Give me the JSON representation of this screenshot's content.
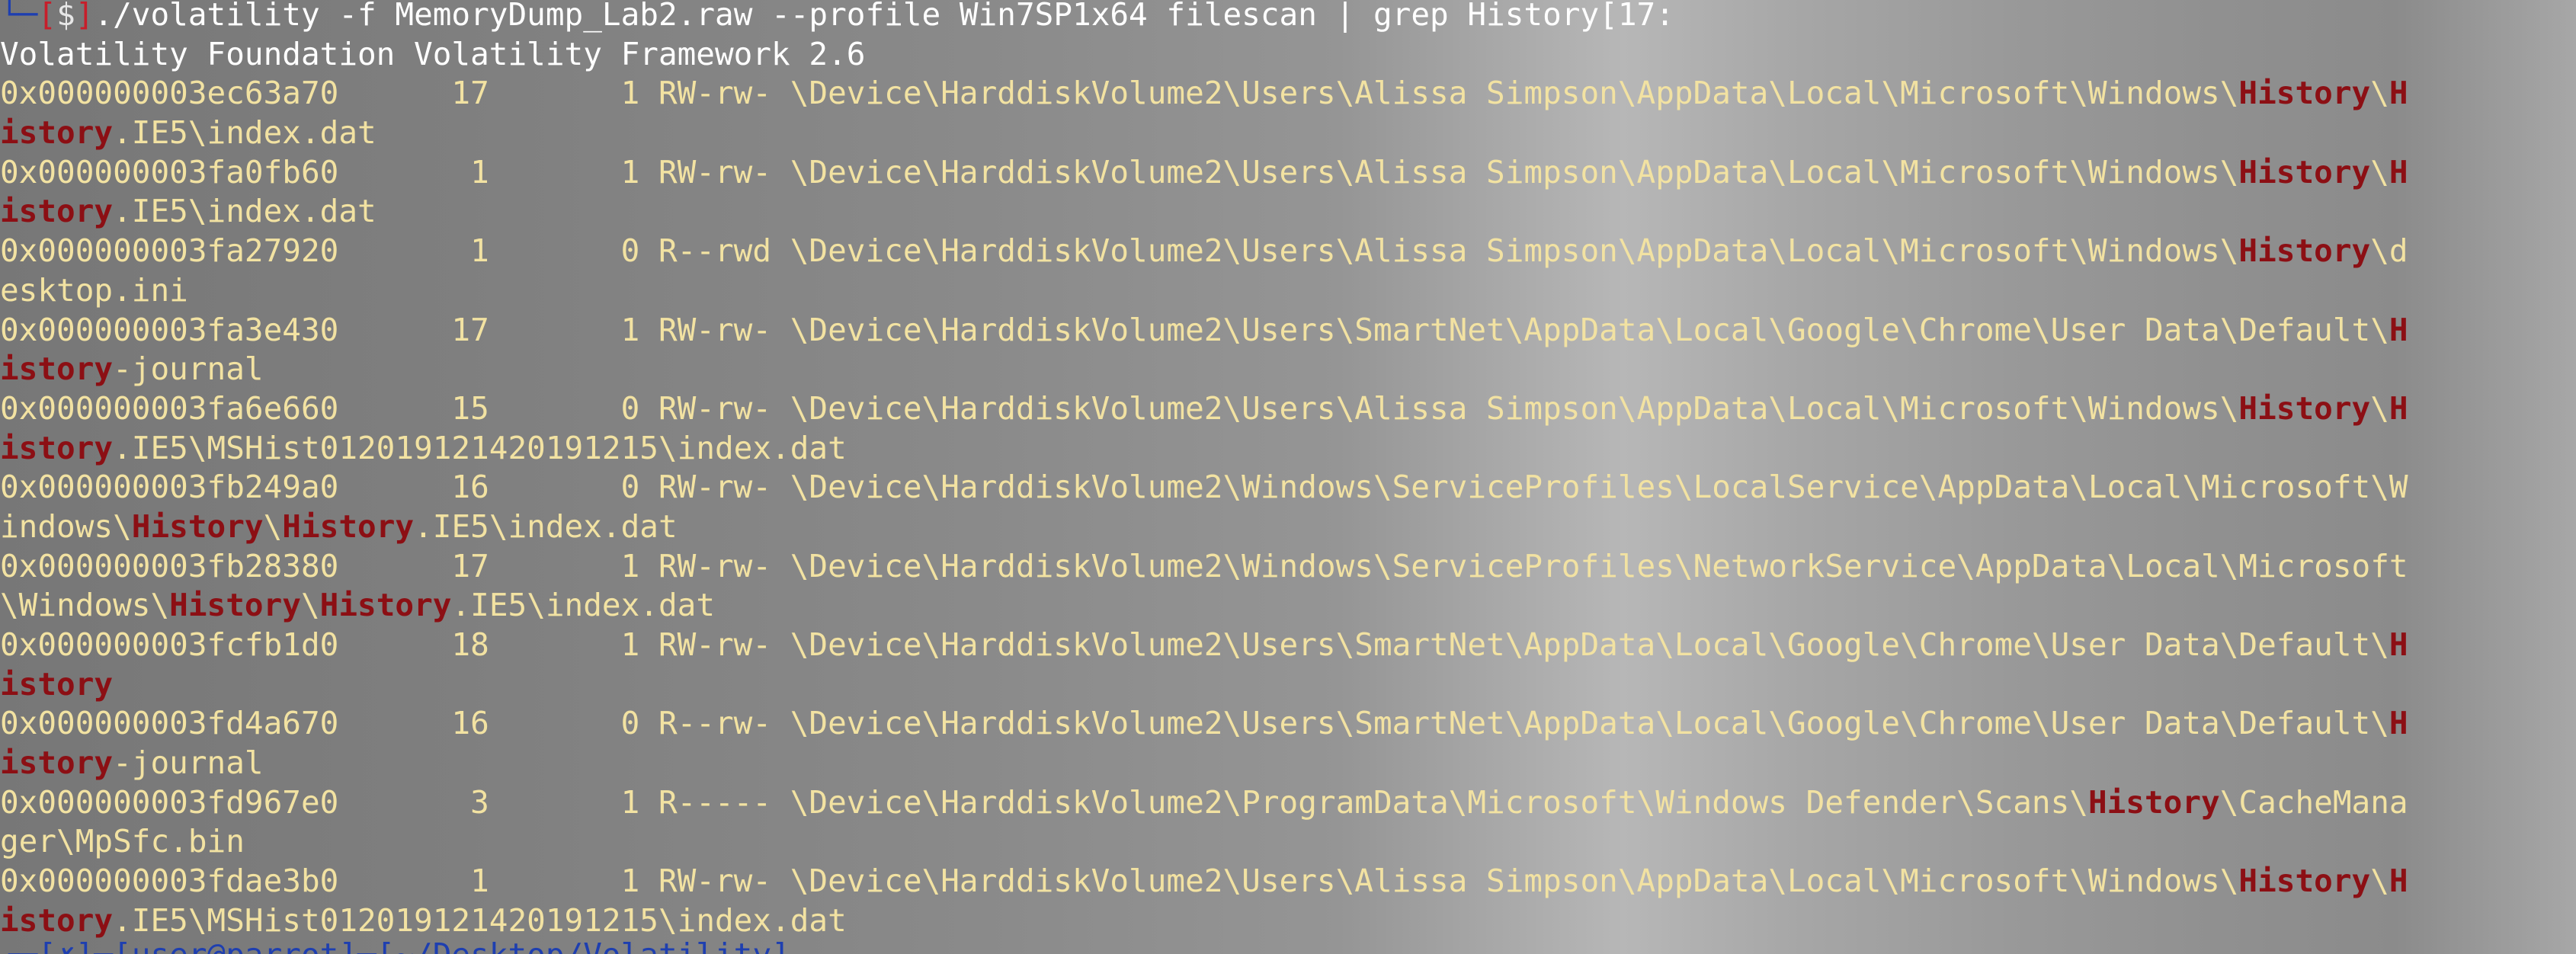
{
  "terminal": {
    "prompt": {
      "corner": "└─",
      "open": "[",
      "symbol": "$",
      "close": "]",
      "command": "./volatility -f MemoryDump_Lab2.raw --profile Win7SP1x64 filescan | grep History",
      "time": "[17:"
    },
    "banner": "Volatility Foundation Volatility Framework 2.6",
    "rows": [
      [
        {
          "t": "0x000000003ec63a70      17       1 RW-rw- \\Device\\HarddiskVolume2\\Users\\Alissa Simpson\\AppData\\Local\\Microsoft\\Windows\\"
        },
        {
          "t": "History",
          "h": true
        },
        {
          "t": "\\"
        },
        {
          "t": "H",
          "h": true
        }
      ],
      [
        {
          "t": "istory",
          "h": true
        },
        {
          "t": ".IE5\\index.dat"
        }
      ],
      [
        {
          "t": "0x000000003fa0fb60       1       1 RW-rw- \\Device\\HarddiskVolume2\\Users\\Alissa Simpson\\AppData\\Local\\Microsoft\\Windows\\"
        },
        {
          "t": "History",
          "h": true
        },
        {
          "t": "\\"
        },
        {
          "t": "H",
          "h": true
        }
      ],
      [
        {
          "t": "istory",
          "h": true
        },
        {
          "t": ".IE5\\index.dat"
        }
      ],
      [
        {
          "t": "0x000000003fa27920       1       0 R--rwd \\Device\\HarddiskVolume2\\Users\\Alissa Simpson\\AppData\\Local\\Microsoft\\Windows\\"
        },
        {
          "t": "History",
          "h": true
        },
        {
          "t": "\\d"
        }
      ],
      [
        {
          "t": "esktop.ini"
        }
      ],
      [
        {
          "t": "0x000000003fa3e430      17       1 RW-rw- \\Device\\HarddiskVolume2\\Users\\SmartNet\\AppData\\Local\\Google\\Chrome\\User Data\\Default\\"
        },
        {
          "t": "H",
          "h": true
        }
      ],
      [
        {
          "t": "istory",
          "h": true
        },
        {
          "t": "-journal"
        }
      ],
      [
        {
          "t": "0x000000003fa6e660      15       0 RW-rw- \\Device\\HarddiskVolume2\\Users\\Alissa Simpson\\AppData\\Local\\Microsoft\\Windows\\"
        },
        {
          "t": "History",
          "h": true
        },
        {
          "t": "\\"
        },
        {
          "t": "H",
          "h": true
        }
      ],
      [
        {
          "t": "istory",
          "h": true
        },
        {
          "t": ".IE5\\MSHist012019121420191215\\index.dat"
        }
      ],
      [
        {
          "t": "0x000000003fb249a0      16       0 RW-rw- \\Device\\HarddiskVolume2\\Windows\\ServiceProfiles\\LocalService\\AppData\\Local\\Microsoft\\W"
        }
      ],
      [
        {
          "t": "indows\\"
        },
        {
          "t": "History",
          "h": true
        },
        {
          "t": "\\"
        },
        {
          "t": "History",
          "h": true
        },
        {
          "t": ".IE5\\index.dat"
        }
      ],
      [
        {
          "t": "0x000000003fb28380      17       1 RW-rw- \\Device\\HarddiskVolume2\\Windows\\ServiceProfiles\\NetworkService\\AppData\\Local\\Microsoft"
        }
      ],
      [
        {
          "t": "\\Windows\\"
        },
        {
          "t": "History",
          "h": true
        },
        {
          "t": "\\"
        },
        {
          "t": "History",
          "h": true
        },
        {
          "t": ".IE5\\index.dat"
        }
      ],
      [
        {
          "t": "0x000000003fcfb1d0      18       1 RW-rw- \\Device\\HarddiskVolume2\\Users\\SmartNet\\AppData\\Local\\Google\\Chrome\\User Data\\Default\\"
        },
        {
          "t": "H",
          "h": true
        }
      ],
      [
        {
          "t": "istory",
          "h": true
        }
      ],
      [
        {
          "t": "0x000000003fd4a670      16       0 R--rw- \\Device\\HarddiskVolume2\\Users\\SmartNet\\AppData\\Local\\Google\\Chrome\\User Data\\Default\\"
        },
        {
          "t": "H",
          "h": true
        }
      ],
      [
        {
          "t": "istory",
          "h": true
        },
        {
          "t": "-journal"
        }
      ],
      [
        {
          "t": "0x000000003fd967e0       3       1 R----- \\Device\\HarddiskVolume2\\ProgramData\\Microsoft\\Windows Defender\\Scans\\"
        },
        {
          "t": "History",
          "h": true
        },
        {
          "t": "\\CacheMana"
        }
      ],
      [
        {
          "t": "ger\\MpSfc.bin"
        }
      ],
      [
        {
          "t": "0x000000003fdae3b0       1       1 RW-rw- \\Device\\HarddiskVolume2\\Users\\Alissa Simpson\\AppData\\Local\\Microsoft\\Windows\\"
        },
        {
          "t": "History",
          "h": true
        },
        {
          "t": "\\"
        },
        {
          "t": "H",
          "h": true
        }
      ],
      [
        {
          "t": "istory",
          "h": true
        },
        {
          "t": ".IE5\\MSHist012019121420191215\\index.dat"
        }
      ]
    ],
    "next_prompt_fragment": "┌─[✗]─[user@parrot]─[~/Desktop/Volatility]"
  },
  "colors": {
    "background_mid": "#959595",
    "output_text": "#f2e2a2",
    "match_text": "#8c0f14",
    "prompt_corner": "#1e3fb0",
    "prompt_bracket": "#c71e2a"
  }
}
